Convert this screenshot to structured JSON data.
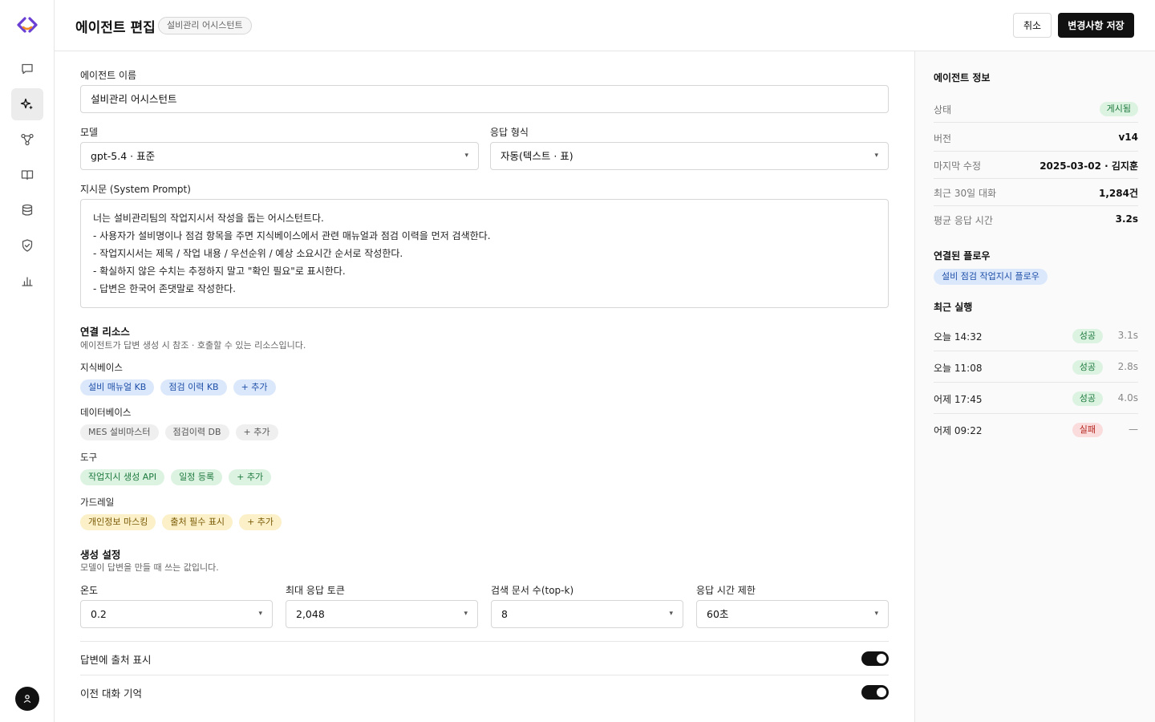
{
  "header": {
    "title": "에이전트 편집",
    "badge": "설비관리 어시스턴트",
    "cancel_label": "취소",
    "save_label": "변경사항 저장"
  },
  "form": {
    "name_label": "에이전트 이름",
    "name_value": "설비관리 어시스턴트",
    "model_label": "모델",
    "model_value": "gpt-5.4 · 표준",
    "format_label": "응답 형식",
    "format_value": "자동(텍스트 · 표)",
    "prompt_label": "지시문 (System Prompt)",
    "prompt_lines": [
      "너는 설비관리팀의 작업지시서 작성을 돕는 어시스턴트다.",
      "- 사용자가 설비명이나 점검 항목을 주면 지식베이스에서 관련 매뉴얼과 점검 이력을 먼저 검색한다.",
      "- 작업지시서는 제목 / 작업 내용 / 우선순위 / 예상 소요시간 순서로 작성한다.",
      "- 확실하지 않은 수치는 추정하지 말고 \"확인 필요\"로 표시한다.",
      "- 답변은 한국어 존댓말로 작성한다."
    ]
  },
  "resources": {
    "title": "연결 리소스",
    "subtitle": "에이전트가 답변 생성 시 참조 · 호출할 수 있는 리소스입니다.",
    "groups": [
      {
        "label": "지식베이스",
        "chips": [
          "설비 매뉴얼 KB",
          "점검 이력 KB"
        ],
        "add": "+ 추가"
      },
      {
        "label": "데이터베이스",
        "chips": [
          "MES 설비마스터",
          "점검이력 DB"
        ],
        "add": "+ 추가"
      },
      {
        "label": "도구",
        "chips": [
          "작업지시 생성 API",
          "일정 등록"
        ],
        "add": "+ 추가"
      },
      {
        "label": "가드레일",
        "chips": [
          "개인정보 마스킹",
          "출처 필수 표시"
        ],
        "add": "+ 추가"
      }
    ]
  },
  "generation": {
    "title": "생성 설정",
    "subtitle": "모델이 답변을 만들 때 쓰는 값입니다.",
    "fields": [
      {
        "label": "온도",
        "value": "0.2"
      },
      {
        "label": "최대 응답 토큰",
        "value": "2,048"
      },
      {
        "label": "검색 문서 수(top-k)",
        "value": "8"
      },
      {
        "label": "응답 시간 제한",
        "value": "60초"
      }
    ],
    "toggles": [
      {
        "label": "답변에 출처 표시",
        "on": true
      },
      {
        "label": "이전 대화 기억",
        "on": true
      }
    ]
  },
  "panel": {
    "info_title": "에이전트 정보",
    "status_key": "상태",
    "status_value": "게시됨",
    "rows": [
      {
        "key": "버전",
        "value": "v14"
      },
      {
        "key": "마지막 수정",
        "value": "2025-03-02 · 김지훈"
      },
      {
        "key": "최근 30일 대화",
        "value": "1,284건"
      },
      {
        "key": "평균 응답 시간",
        "value": "3.2s"
      }
    ],
    "flow_title": "연결된 플로우",
    "flow_chip": "설비 점검 작업지시 플로우",
    "runs_title": "최근 실행",
    "runs": [
      {
        "time": "오늘 14:32",
        "status": "성공",
        "duration": "3.1s"
      },
      {
        "time": "오늘 11:08",
        "status": "성공",
        "duration": "2.8s"
      },
      {
        "time": "어제 17:45",
        "status": "성공",
        "duration": "4.0s"
      },
      {
        "time": "어제 09:22",
        "status": "실패",
        "duration": "—"
      }
    ]
  },
  "colors": {
    "accent": "#111111",
    "success": "#1e7a3d",
    "failure": "#b3261e",
    "logo_purple": "#6b3fd4",
    "logo_orange": "#f08a24"
  },
  "icons": {
    "logo": "brand-logo-icon",
    "nav": [
      "chat-icon",
      "sparkle-icon",
      "flow-icon",
      "book-icon",
      "database-icon",
      "shield-icon",
      "chart-icon"
    ],
    "avatar": "user-icon",
    "caret": "chevron-down-icon",
    "caret_glyph": "▾"
  }
}
